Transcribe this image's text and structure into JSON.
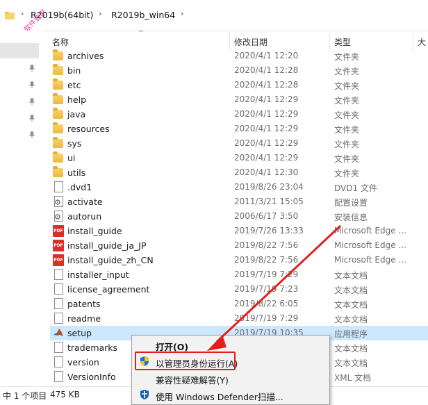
{
  "address_bar": {
    "crumbs": [
      "R2019b(64bit)",
      "R2019b_win64"
    ],
    "separator": "›"
  },
  "watermark": "公众号：软件管家",
  "columns": {
    "name": "名称",
    "date": "修改日期",
    "type": "类型",
    "size": "大"
  },
  "files": [
    {
      "name": "archives",
      "date": "2020/4/1 12:20",
      "type": "文件夹",
      "icon": "folder-icon"
    },
    {
      "name": "bin",
      "date": "2020/4/1 12:28",
      "type": "文件夹",
      "icon": "folder-icon"
    },
    {
      "name": "etc",
      "date": "2020/4/1 12:28",
      "type": "文件夹",
      "icon": "folder-icon"
    },
    {
      "name": "help",
      "date": "2020/4/1 12:29",
      "type": "文件夹",
      "icon": "folder-icon"
    },
    {
      "name": "java",
      "date": "2020/4/1 12:29",
      "type": "文件夹",
      "icon": "folder-icon"
    },
    {
      "name": "resources",
      "date": "2020/4/1 12:29",
      "type": "文件夹",
      "icon": "folder-icon"
    },
    {
      "name": "sys",
      "date": "2020/4/1 12:29",
      "type": "文件夹",
      "icon": "folder-icon"
    },
    {
      "name": "ui",
      "date": "2020/4/1 12:29",
      "type": "文件夹",
      "icon": "folder-icon"
    },
    {
      "name": "utils",
      "date": "2020/4/1 12:30",
      "type": "文件夹",
      "icon": "folder-icon"
    },
    {
      "name": ".dvd1",
      "date": "2019/8/26 23:04",
      "type": "DVD1 文件",
      "icon": "file-icon"
    },
    {
      "name": "activate",
      "date": "2011/3/21 15:05",
      "type": "配置设置",
      "icon": "config-file-icon"
    },
    {
      "name": "autorun",
      "date": "2006/6/17 3:50",
      "type": "安装信息",
      "icon": "config-file-icon"
    },
    {
      "name": "install_guide",
      "date": "2019/7/26 13:33",
      "type": "Microsoft Edge ...",
      "icon": "pdf-icon"
    },
    {
      "name": "install_guide_ja_JP",
      "date": "2019/8/22 7:56",
      "type": "Microsoft Edge ...",
      "icon": "pdf-icon"
    },
    {
      "name": "install_guide_zh_CN",
      "date": "2019/8/22 7:56",
      "type": "Microsoft Edge ...",
      "icon": "pdf-icon"
    },
    {
      "name": "installer_input",
      "date": "2019/7/19 7:29",
      "type": "文本文档",
      "icon": "text-file-icon"
    },
    {
      "name": "license_agreement",
      "date": "2019/7/19 7:23",
      "type": "文本文档",
      "icon": "text-file-icon"
    },
    {
      "name": "patents",
      "date": "2019/8/22 6:05",
      "type": "文本文档",
      "icon": "text-file-icon"
    },
    {
      "name": "readme",
      "date": "2019/7/19 7:29",
      "type": "文本文档",
      "icon": "text-file-icon"
    },
    {
      "name": "setup",
      "date": "2019/7/19 10:35",
      "type": "应用程序",
      "icon": "matlab-setup-icon"
    },
    {
      "name": "trademarks",
      "date": "",
      "type": "文本文档",
      "icon": "text-file-icon"
    },
    {
      "name": "version",
      "date": "",
      "type": "文本文档",
      "icon": "text-file-icon"
    },
    {
      "name": "VersionInfo",
      "date": "",
      "type": "XML 文档",
      "icon": "xml-file-icon"
    }
  ],
  "context_menu": {
    "items": [
      {
        "label": "打开(O)",
        "bold": true
      },
      {
        "label": "以管理员身份运行(A)",
        "icon": "uac-shield-icon"
      },
      {
        "label": "兼容性疑难解答(Y)"
      },
      {
        "label": "使用 Windows Defender扫描...",
        "icon": "defender-icon"
      }
    ]
  },
  "status_bar": {
    "count": "中 1 个项目",
    "size": "475 KB"
  },
  "colors": {
    "selected_row": "#cce8ff",
    "annotation_red": "#e0201c",
    "folder": "#f0b83a",
    "pdf": "#d9302a"
  }
}
